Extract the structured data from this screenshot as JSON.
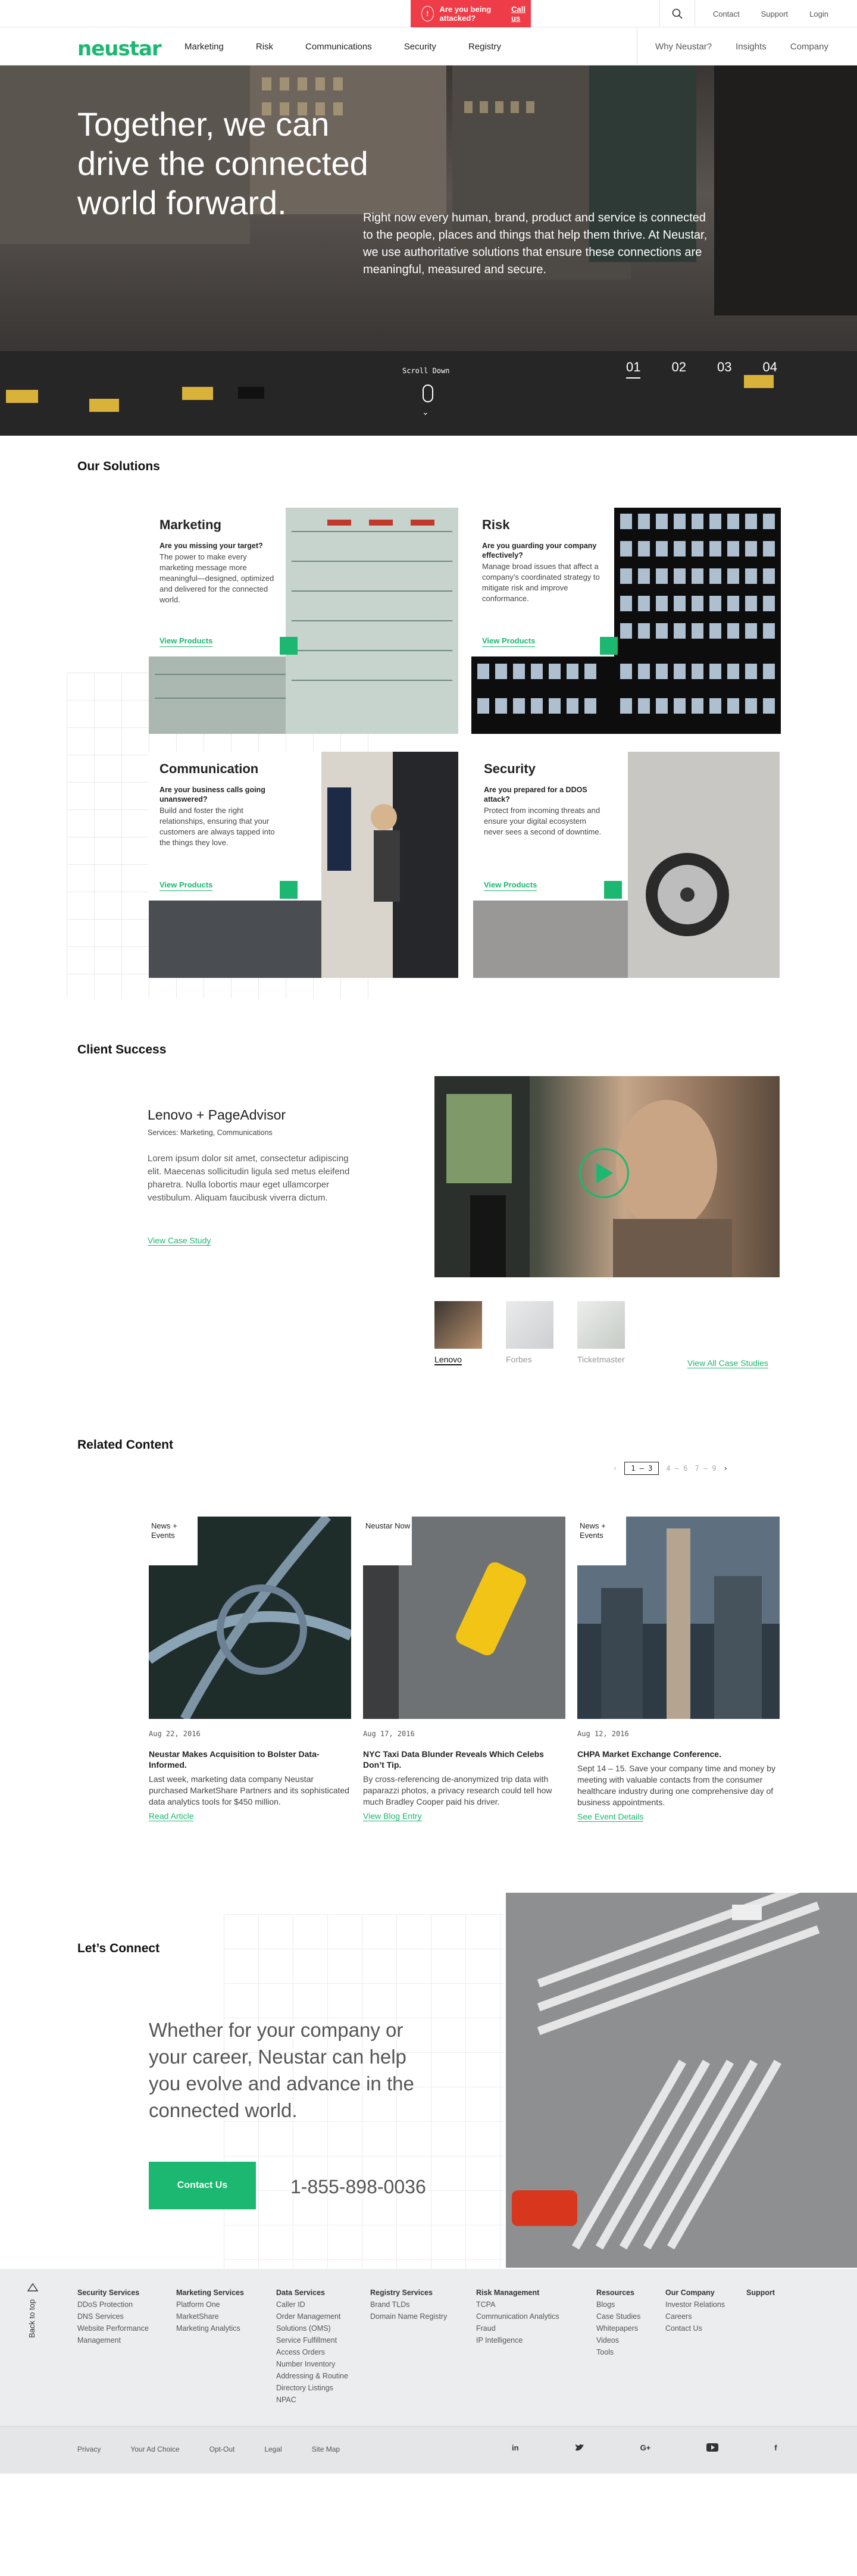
{
  "utility": {
    "alert_text": "Are you being attacked?",
    "alert_link": "Call us",
    "links": [
      "Contact",
      "Support",
      "Login"
    ]
  },
  "nav": {
    "logo": "neustar",
    "main": [
      "Marketing",
      "Risk",
      "Communications",
      "Security",
      "Registry"
    ],
    "right": [
      "Why Neustar?",
      "Insights",
      "Company"
    ]
  },
  "hero": {
    "title": "Together, we can drive the connected world forward.",
    "body": "Right now every human, brand, product and service is connected to the people, places and things that help them thrive. At Neustar, we use authoritative solutions that ensure these connections are meaningful, measured and secure.",
    "scroll_label": "Scroll Down",
    "slides": [
      "01",
      "02",
      "03",
      "04"
    ],
    "active_slide": 0
  },
  "solutions": {
    "heading": "Our Solutions",
    "items": [
      {
        "title": "Marketing",
        "question": "Are you missing your target?",
        "desc": "The power to make every marketing message more meaningful—designed, optimized and delivered for the connected world.",
        "link": "View Products"
      },
      {
        "title": "Risk",
        "question": "Are you guarding your company effectively?",
        "desc": "Manage broad issues that affect a company’s coordinated strategy to mitigate risk and improve conformance.",
        "link": "View Products"
      },
      {
        "title": "Communication",
        "question": "Are your business calls going unanswered?",
        "desc": "Build and foster the right relationships, ensuring that your customers are always tapped into the things they love.",
        "link": "View Products"
      },
      {
        "title": "Security",
        "question": "Are you prepared for a DDOS attack?",
        "desc": "Protect from incoming threats and ensure your digital ecosystem never sees a second of downtime.",
        "link": "View Products"
      }
    ]
  },
  "client_success": {
    "heading": "Client Success",
    "title": "Lenovo + PageAdvisor",
    "services": "Services: Marketing, Communications",
    "body": "Lorem ipsum dolor sit amet, consectetur adipiscing elit. Maecenas sollicitudin ligula sed metus eleifend pharetra. Nulla lobortis maur eget ullamcorper vestibulum. Aliquam faucibusk viverra dictum.",
    "link": "View Case Study",
    "thumbs": [
      "Lenovo",
      "Forbes",
      "Ticketmaster"
    ],
    "all_link": "View All Case Studies"
  },
  "related": {
    "heading": "Related Content",
    "pager": {
      "current": "1 – 3",
      "next": "4 – 6",
      "later": "7 – 9"
    },
    "items": [
      {
        "tag": "News + Events",
        "date": "Aug 22, 2016",
        "title": "Neustar Makes Acquisition to Bolster Data-Informed.",
        "body": "Last week, marketing data company Neustar purchased MarketShare Partners and its sophisticated data analytics tools for $450 million.",
        "link": "Read Article"
      },
      {
        "tag": "Neustar Now",
        "date": "Aug 17, 2016",
        "title": "NYC Taxi Data Blunder Reveals Which Celebs Don’t Tip.",
        "body": "By cross-referencing de-anonymized trip data with paparazzi photos, a privacy research could tell how much Bradley Cooper paid his driver.",
        "link": "View Blog Entry"
      },
      {
        "tag": "News + Events",
        "date": "Aug 12, 2016",
        "title": "CHPA Market Exchange Conference.",
        "body": "Sept 14 – 15. Save your company time and money by meeting with valuable contacts from the consumer healthcare industry during one comprehensive day of business appointments.",
        "link": "See Event Details"
      }
    ]
  },
  "connect": {
    "heading": "Let’s Connect",
    "text": "Whether for your company or your career, Neustar can help you evolve and advance in the connected world.",
    "button": "Contact Us",
    "phone": "1-855-898-0036"
  },
  "footer": {
    "back_to_top": "Back to top",
    "columns": [
      {
        "heading": "Security Services",
        "items": [
          "DDoS Protection",
          "DNS Services",
          "Website Performance Management"
        ]
      },
      {
        "heading": "Marketing Services",
        "items": [
          "Platform One",
          "MarketShare",
          "Marketing Analytics"
        ]
      },
      {
        "heading": "Data Services",
        "items": [
          "Caller ID",
          "Order Management Solutions (OMS)",
          "Service Fulfillment",
          "Access Orders",
          "Number Inventory",
          "Addressing & Routine",
          "Directory Listings",
          "NPAC"
        ]
      },
      {
        "heading": "Registry Services",
        "items": [
          "Brand TLDs",
          "Domain Name Registry"
        ]
      },
      {
        "heading": "Risk Management",
        "items": [
          "TCPA",
          "Communication Analytics",
          "Fraud",
          "IP Intelligence"
        ]
      },
      {
        "heading": "Resources",
        "items": [
          "Blogs",
          "Case Studies",
          "Whitepapers",
          "Videos",
          "Tools"
        ]
      },
      {
        "heading": "Our Company",
        "items": [
          "Investor Relations",
          "Careers",
          "Contact Us"
        ]
      },
      {
        "heading": "Support",
        "items": []
      }
    ],
    "bottom_links": [
      "Privacy",
      "Your Ad Choice",
      "Opt-Out",
      "Legal",
      "Site Map"
    ],
    "social": [
      "in",
      "𝕏",
      "G+",
      "▶",
      "f"
    ]
  },
  "colors": {
    "accent": "#1cb770",
    "alert": "#ee3d48"
  }
}
